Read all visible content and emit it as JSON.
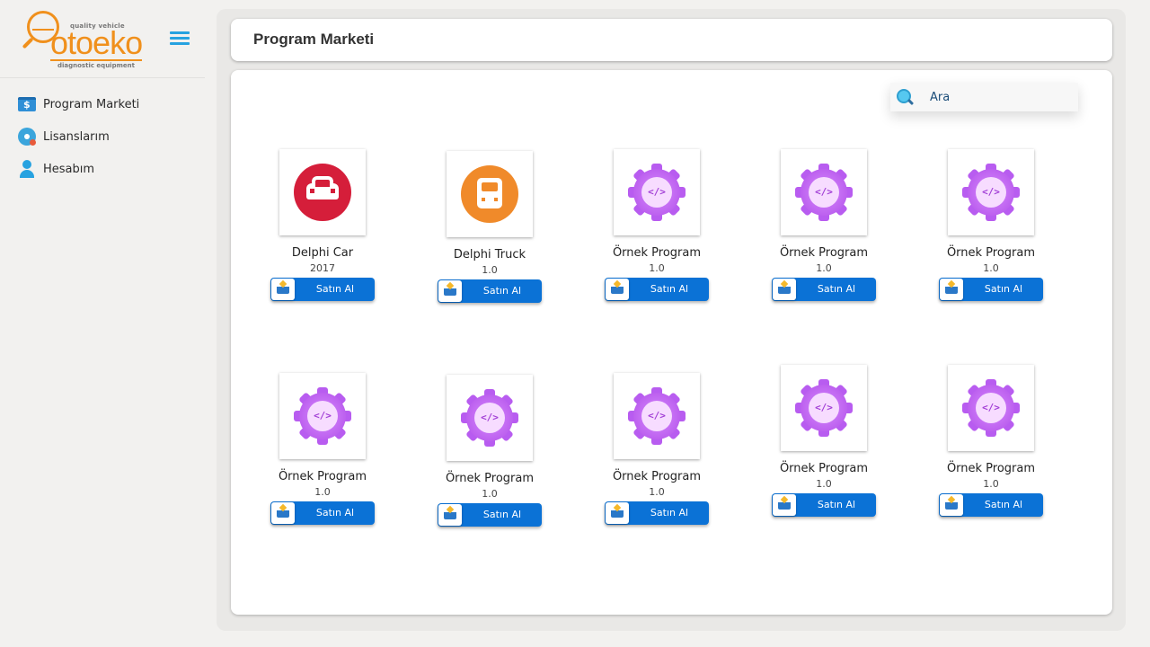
{
  "sidebar": {
    "logo": {
      "tagline_top": "quality vehicle",
      "brand": "otoeko",
      "tagline_bottom": "diagnostic equipment"
    },
    "items": [
      {
        "label": "Program Marketi",
        "icon": "money-icon"
      },
      {
        "label": "Lisanslarım",
        "icon": "disc-icon"
      },
      {
        "label": "Hesabım",
        "icon": "user-icon"
      }
    ]
  },
  "header": {
    "title": "Program Marketi"
  },
  "search": {
    "placeholder": "Ara",
    "value": ""
  },
  "products": [
    {
      "name": "Delphi Car",
      "version": "2017",
      "icon": "car-icon",
      "buy_label": "Satın Al"
    },
    {
      "name": "Delphi Truck",
      "version": "1.0",
      "icon": "truck-icon",
      "buy_label": "Satın Al"
    },
    {
      "name": "Örnek Program",
      "version": "1.0",
      "icon": "gear-code-icon",
      "buy_label": "Satın Al"
    },
    {
      "name": "Örnek Program",
      "version": "1.0",
      "icon": "gear-code-icon",
      "buy_label": "Satın Al"
    },
    {
      "name": "Örnek Program",
      "version": "1.0",
      "icon": "gear-code-icon",
      "buy_label": "Satın Al"
    },
    {
      "name": "Örnek Program",
      "version": "1.0",
      "icon": "gear-code-icon",
      "buy_label": "Satın Al"
    },
    {
      "name": "Örnek Program",
      "version": "1.0",
      "icon": "gear-code-icon",
      "buy_label": "Satın Al"
    },
    {
      "name": "Örnek Program",
      "version": "1.0",
      "icon": "gear-code-icon",
      "buy_label": "Satın Al"
    },
    {
      "name": "Örnek Program",
      "version": "1.0",
      "icon": "gear-code-icon",
      "buy_label": "Satın Al"
    },
    {
      "name": "Örnek Program",
      "version": "1.0",
      "icon": "gear-code-icon",
      "buy_label": "Satın Al"
    }
  ],
  "colors": {
    "accent": "#0b72d6",
    "brand": "#f0901c",
    "car": "#d51e3a",
    "truck": "#f08a2a",
    "gear": "#b85cf0"
  }
}
